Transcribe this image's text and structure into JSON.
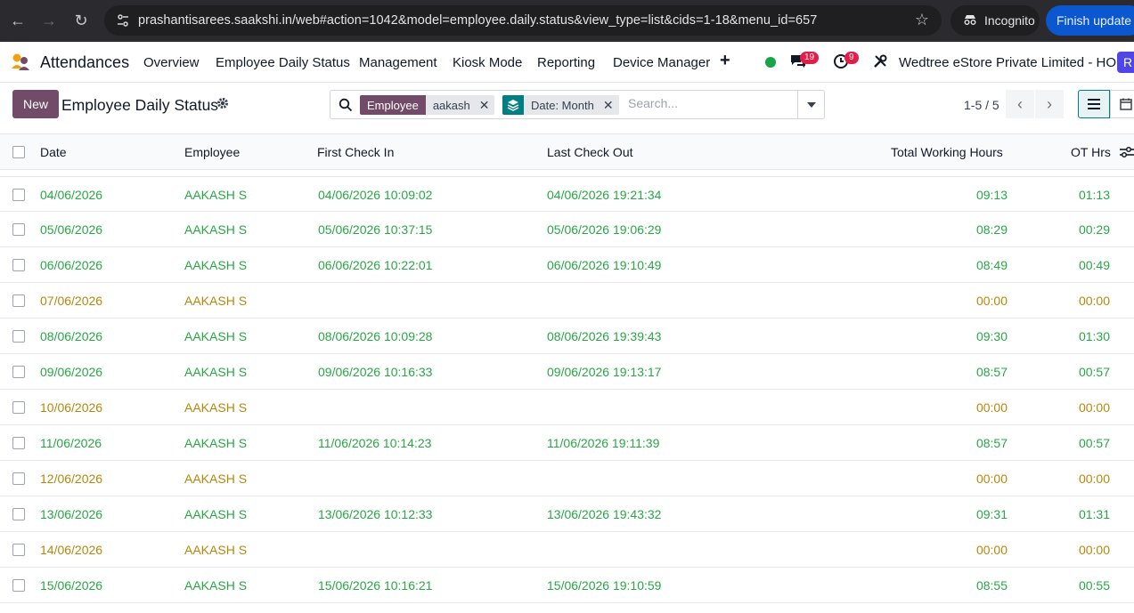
{
  "browser": {
    "url": "prashantisarees.saakshi.in/web#action=1042&model=employee.daily.status&view_type=list&cids=1-18&menu_id=657",
    "incognito_label": "Incognito",
    "finish_update_label": "Finish update"
  },
  "navbar": {
    "app_name": "Attendances",
    "menu": [
      "Overview",
      "Employee Daily Status",
      "Management",
      "Kiosk Mode",
      "Reporting",
      "Device Manager"
    ],
    "plus": "+",
    "chat_count": "19",
    "activity_count": "9",
    "company": "Wedtree eStore Private Limited - HO",
    "avatar_letter": "R"
  },
  "control_panel": {
    "new_label": "New",
    "title": "Employee Daily Status",
    "facets": [
      {
        "tag": "Employee",
        "value": "aakash",
        "color": "#714B67"
      },
      {
        "tag": "Date: Month",
        "value": "",
        "color": "#017e84"
      }
    ],
    "search_placeholder": "Search...",
    "pager": "1-5 / 5"
  },
  "table": {
    "columns": [
      "Date",
      "Employee",
      "First Check In",
      "Last Check Out",
      "Total Working Hours",
      "OT Hrs"
    ],
    "rows": [
      {
        "status": "present",
        "date": "04/06/2026",
        "employee": "AAKASH S",
        "check_in": "04/06/2026 10:09:02",
        "check_out": "04/06/2026 19:21:34",
        "hours": "09:13",
        "ot": "01:13"
      },
      {
        "status": "present",
        "date": "05/06/2026",
        "employee": "AAKASH S",
        "check_in": "05/06/2026 10:37:15",
        "check_out": "05/06/2026 19:06:29",
        "hours": "08:29",
        "ot": "00:29"
      },
      {
        "status": "present",
        "date": "06/06/2026",
        "employee": "AAKASH S",
        "check_in": "06/06/2026 10:22:01",
        "check_out": "06/06/2026 19:10:49",
        "hours": "08:49",
        "ot": "00:49"
      },
      {
        "status": "absent",
        "date": "07/06/2026",
        "employee": "AAKASH S",
        "check_in": "",
        "check_out": "",
        "hours": "00:00",
        "ot": "00:00"
      },
      {
        "status": "present",
        "date": "08/06/2026",
        "employee": "AAKASH S",
        "check_in": "08/06/2026 10:09:28",
        "check_out": "08/06/2026 19:39:43",
        "hours": "09:30",
        "ot": "01:30"
      },
      {
        "status": "present",
        "date": "09/06/2026",
        "employee": "AAKASH S",
        "check_in": "09/06/2026 10:16:33",
        "check_out": "09/06/2026 19:13:17",
        "hours": "08:57",
        "ot": "00:57"
      },
      {
        "status": "absent",
        "date": "10/06/2026",
        "employee": "AAKASH S",
        "check_in": "",
        "check_out": "",
        "hours": "00:00",
        "ot": "00:00"
      },
      {
        "status": "present",
        "date": "11/06/2026",
        "employee": "AAKASH S",
        "check_in": "11/06/2026 10:14:23",
        "check_out": "11/06/2026 19:11:39",
        "hours": "08:57",
        "ot": "00:57"
      },
      {
        "status": "absent",
        "date": "12/06/2026",
        "employee": "AAKASH S",
        "check_in": "",
        "check_out": "",
        "hours": "00:00",
        "ot": "00:00"
      },
      {
        "status": "present",
        "date": "13/06/2026",
        "employee": "AAKASH S",
        "check_in": "13/06/2026 10:12:33",
        "check_out": "13/06/2026 19:43:32",
        "hours": "09:31",
        "ot": "01:31"
      },
      {
        "status": "absent",
        "date": "14/06/2026",
        "employee": "AAKASH S",
        "check_in": "",
        "check_out": "",
        "hours": "00:00",
        "ot": "00:00"
      },
      {
        "status": "present",
        "date": "15/06/2026",
        "employee": "AAKASH S",
        "check_in": "15/06/2026 10:16:21",
        "check_out": "15/06/2026 19:10:59",
        "hours": "08:55",
        "ot": "00:55"
      }
    ]
  },
  "colors": {
    "present": "#28a745",
    "absent": "#b8860b",
    "primary": "#714B67",
    "teal": "#017e84"
  }
}
